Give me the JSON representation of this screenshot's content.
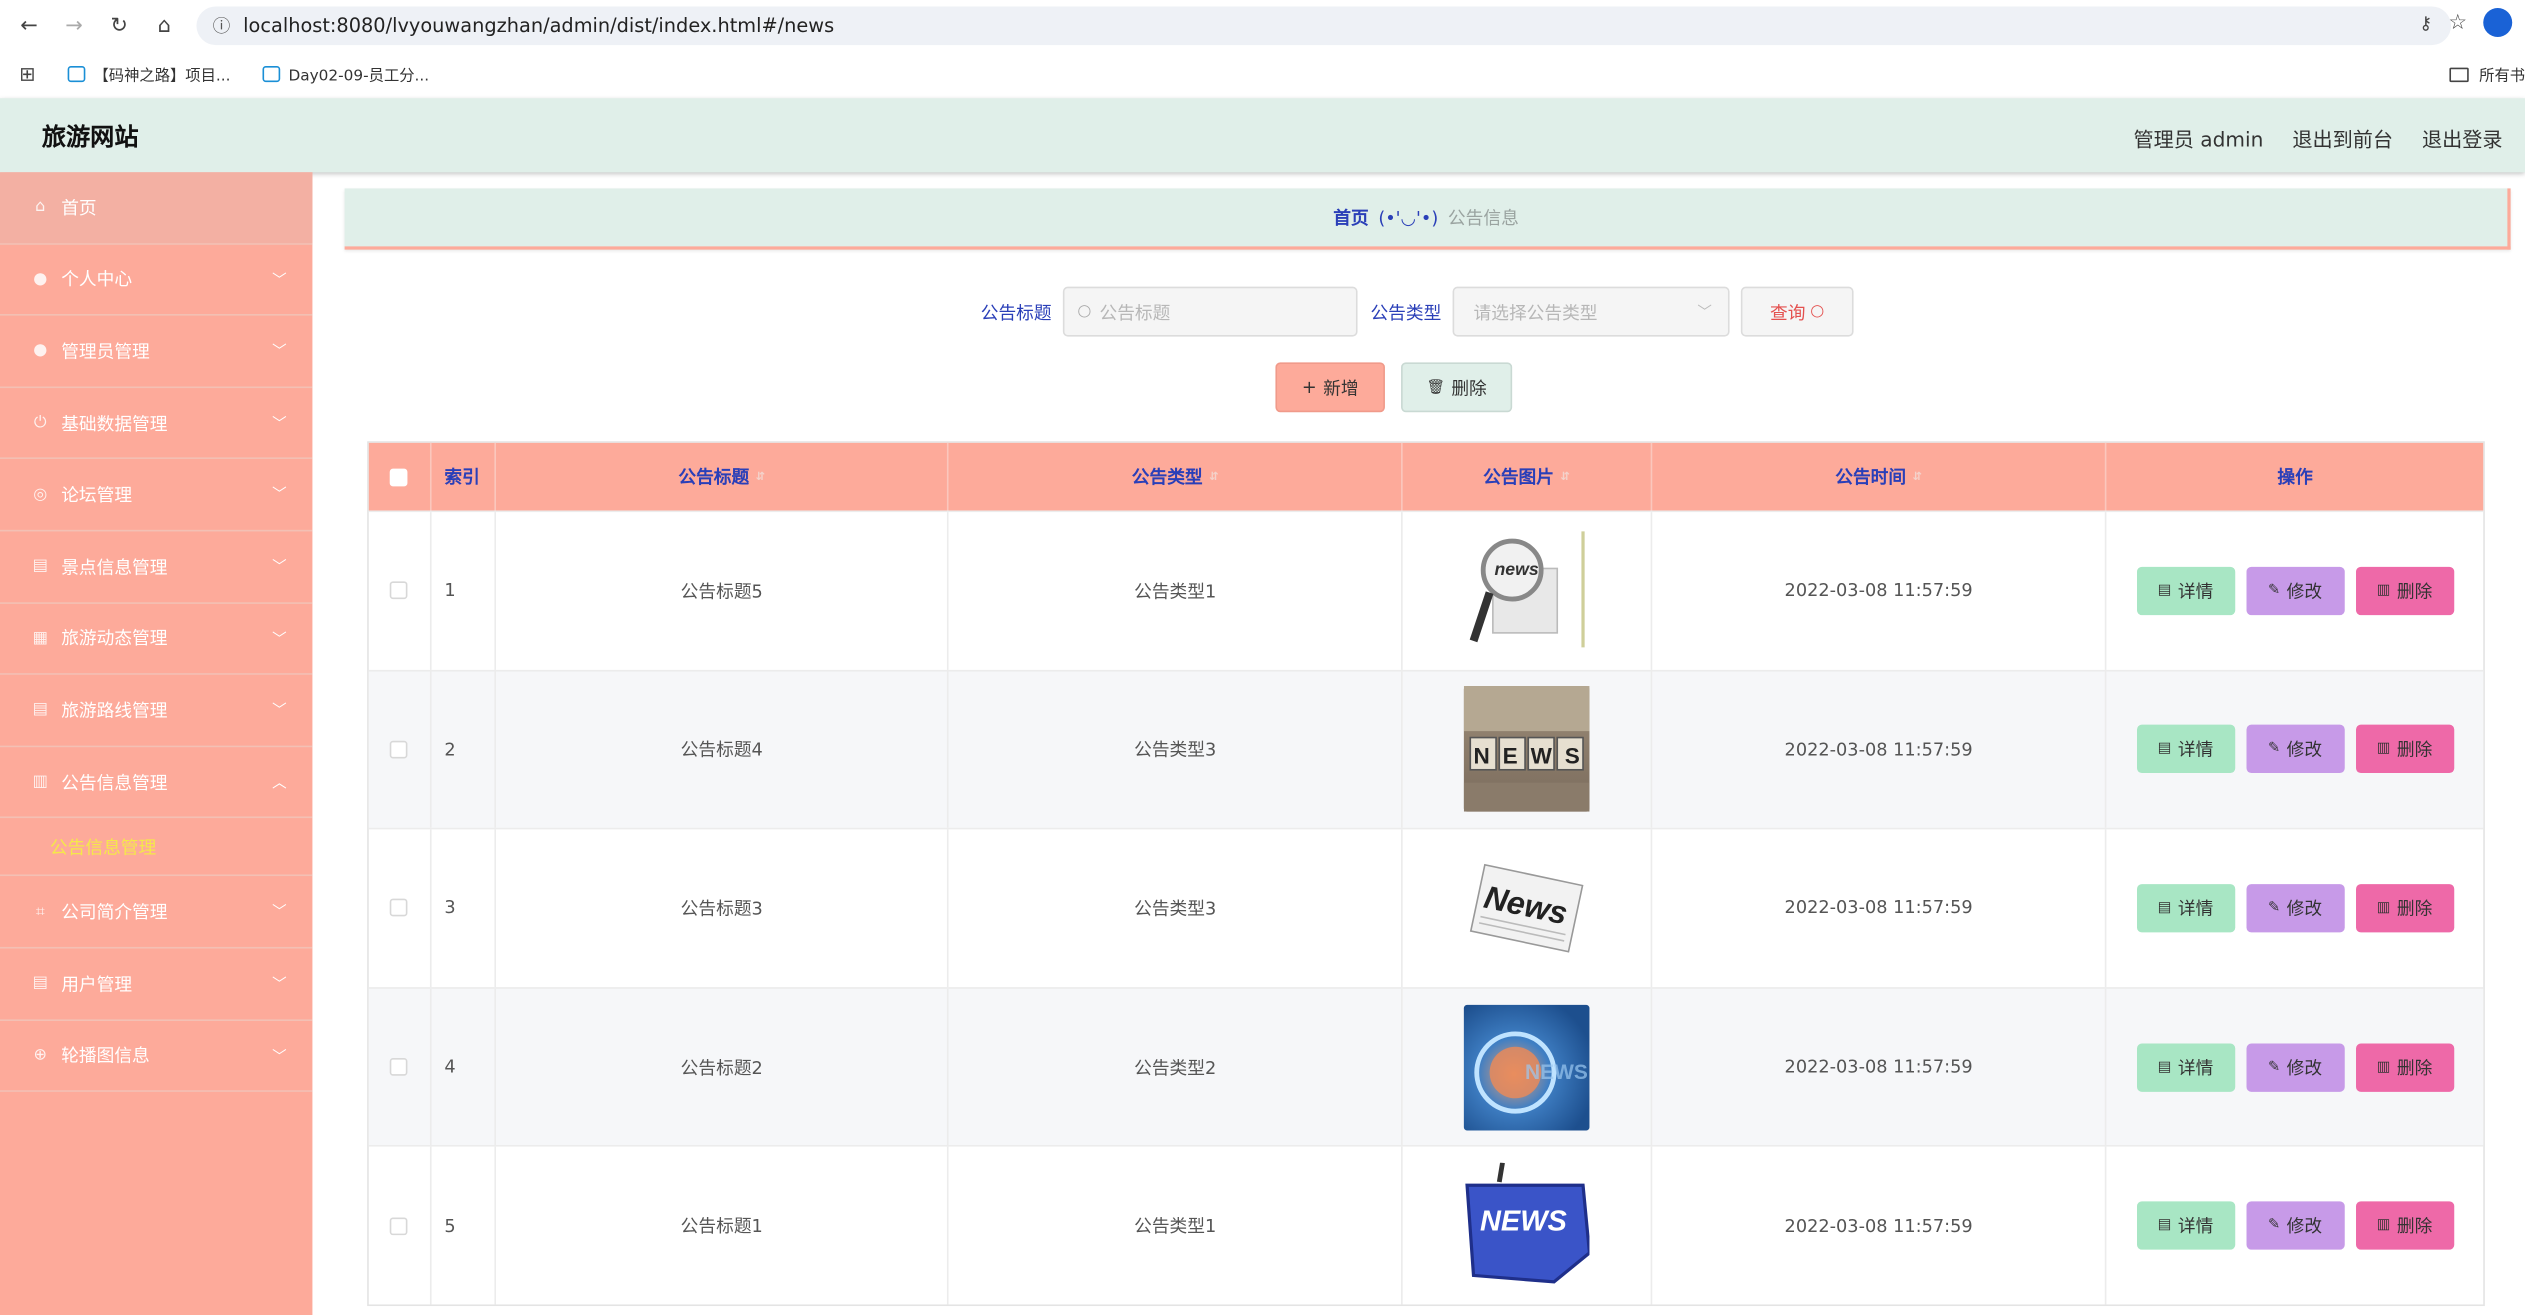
{
  "browser": {
    "url": "localhost:8080/lvyouwangzhan/admin/dist/index.html#/news",
    "bookmarks": [
      "【码神之路】项目...",
      "Day02-09-员工分..."
    ],
    "bookmarks_right": "所有书"
  },
  "header": {
    "title": "旅游网站",
    "user": "管理员 admin",
    "to_front": "退出到前台",
    "logout": "退出登录"
  },
  "sidebar": {
    "items": [
      {
        "label": "首页",
        "icon": "home-icon"
      },
      {
        "label": "个人中心",
        "icon": "user-icon"
      },
      {
        "label": "管理员管理",
        "icon": "bulb-icon"
      },
      {
        "label": "基础数据管理",
        "icon": "power-icon"
      },
      {
        "label": "论坛管理",
        "icon": "compass-icon"
      },
      {
        "label": "景点信息管理",
        "icon": "clipboard-icon"
      },
      {
        "label": "旅游动态管理",
        "icon": "grid-icon"
      },
      {
        "label": "旅游路线管理",
        "icon": "clipboard-icon"
      },
      {
        "label": "公告信息管理",
        "icon": "bar-chart-icon"
      },
      {
        "label": "公司简介管理",
        "icon": "crop-icon"
      },
      {
        "label": "用户管理",
        "icon": "clipboard-icon"
      },
      {
        "label": "轮播图信息",
        "icon": "globe-icon"
      }
    ],
    "sub_active": "公告信息管理"
  },
  "breadcrumb": {
    "home": "首页",
    "sep": "(•'◡'•)",
    "current": "公告信息"
  },
  "search": {
    "title_label": "公告标题",
    "title_placeholder": "公告标题",
    "type_label": "公告类型",
    "type_placeholder": "请选择公告类型",
    "query_btn": "查询"
  },
  "actions": {
    "add": "新增",
    "delete": "删除"
  },
  "table": {
    "headers": [
      "索引",
      "公告标题",
      "公告类型",
      "公告图片",
      "公告时间",
      "操作"
    ],
    "rows": [
      {
        "index": "1",
        "title": "公告标题5",
        "type": "公告类型1",
        "time": "2022-03-08 11:57:59",
        "thumb": "NEWS"
      },
      {
        "index": "2",
        "title": "公告标题4",
        "type": "公告类型3",
        "time": "2022-03-08 11:57:59",
        "thumb": "NEWS"
      },
      {
        "index": "3",
        "title": "公告标题3",
        "type": "公告类型3",
        "time": "2022-03-08 11:57:59",
        "thumb": "News"
      },
      {
        "index": "4",
        "title": "公告标题2",
        "type": "公告类型2",
        "time": "2022-03-08 11:57:59",
        "thumb": "NEWS"
      },
      {
        "index": "5",
        "title": "公告标题1",
        "type": "公告类型1",
        "time": "2022-03-08 11:57:59",
        "thumb": "NEWS"
      }
    ],
    "op_detail": "详情",
    "op_edit": "修改",
    "op_delete": "删除"
  },
  "colors": {
    "accent": "#fdaa9a",
    "header_bg": "#e0efe9",
    "link": "#2a3fb8",
    "detail_btn": "#a8e6c4",
    "edit_btn": "#c79ae8",
    "delete_btn": "#ee69a8"
  }
}
